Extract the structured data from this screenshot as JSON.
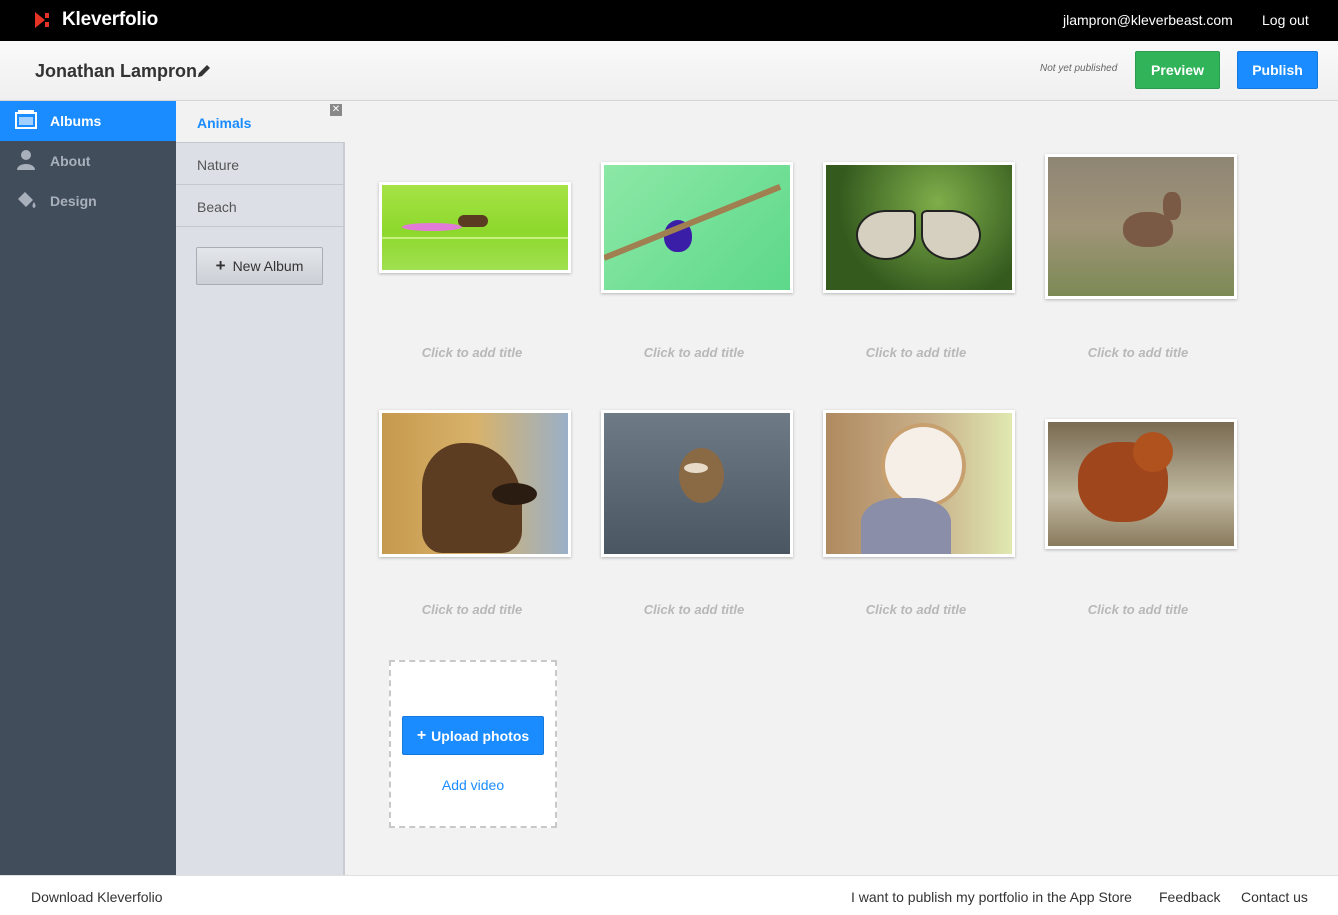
{
  "topbar": {
    "brand": "Kleverfolio",
    "email": "jlampron@kleverbeast.com",
    "logout": "Log out"
  },
  "header": {
    "user_name": "Jonathan Lampron",
    "status": "Not yet published",
    "preview_label": "Preview",
    "publish_label": "Publish"
  },
  "sidebar": {
    "items": [
      {
        "label": "Albums",
        "icon": "albums-icon",
        "active": true
      },
      {
        "label": "About",
        "icon": "person-icon",
        "active": false
      },
      {
        "label": "Design",
        "icon": "paint-bucket-icon",
        "active": false
      }
    ]
  },
  "albums": {
    "items": [
      {
        "label": "Animals",
        "active": true
      },
      {
        "label": "Nature",
        "active": false
      },
      {
        "label": "Beach",
        "active": false
      }
    ],
    "new_album_label": "New Album"
  },
  "photos": [
    {
      "subject": "ant on flower",
      "title_placeholder": "Click to add title"
    },
    {
      "subject": "purple bird on branch",
      "title_placeholder": "Click to add title"
    },
    {
      "subject": "butterfly",
      "title_placeholder": "Click to add title"
    },
    {
      "subject": "fawn deer",
      "title_placeholder": "Click to add title"
    },
    {
      "subject": "dog",
      "title_placeholder": "Click to add title"
    },
    {
      "subject": "duckling",
      "title_placeholder": "Click to add title"
    },
    {
      "subject": "barn owl",
      "title_placeholder": "Click to add title"
    },
    {
      "subject": "red squirrel",
      "title_placeholder": "Click to add title"
    }
  ],
  "upload": {
    "upload_label": "Upload photos",
    "add_video_label": "Add video"
  },
  "footer": {
    "download": "Download Kleverfolio",
    "app_store": "I want to publish my portfolio in the App Store",
    "feedback": "Feedback",
    "contact": "Contact us"
  },
  "colors": {
    "accent": "#1a8cff",
    "preview": "#31b35a",
    "sidebar": "#424d5c",
    "album_panel": "#dcdfe6"
  }
}
